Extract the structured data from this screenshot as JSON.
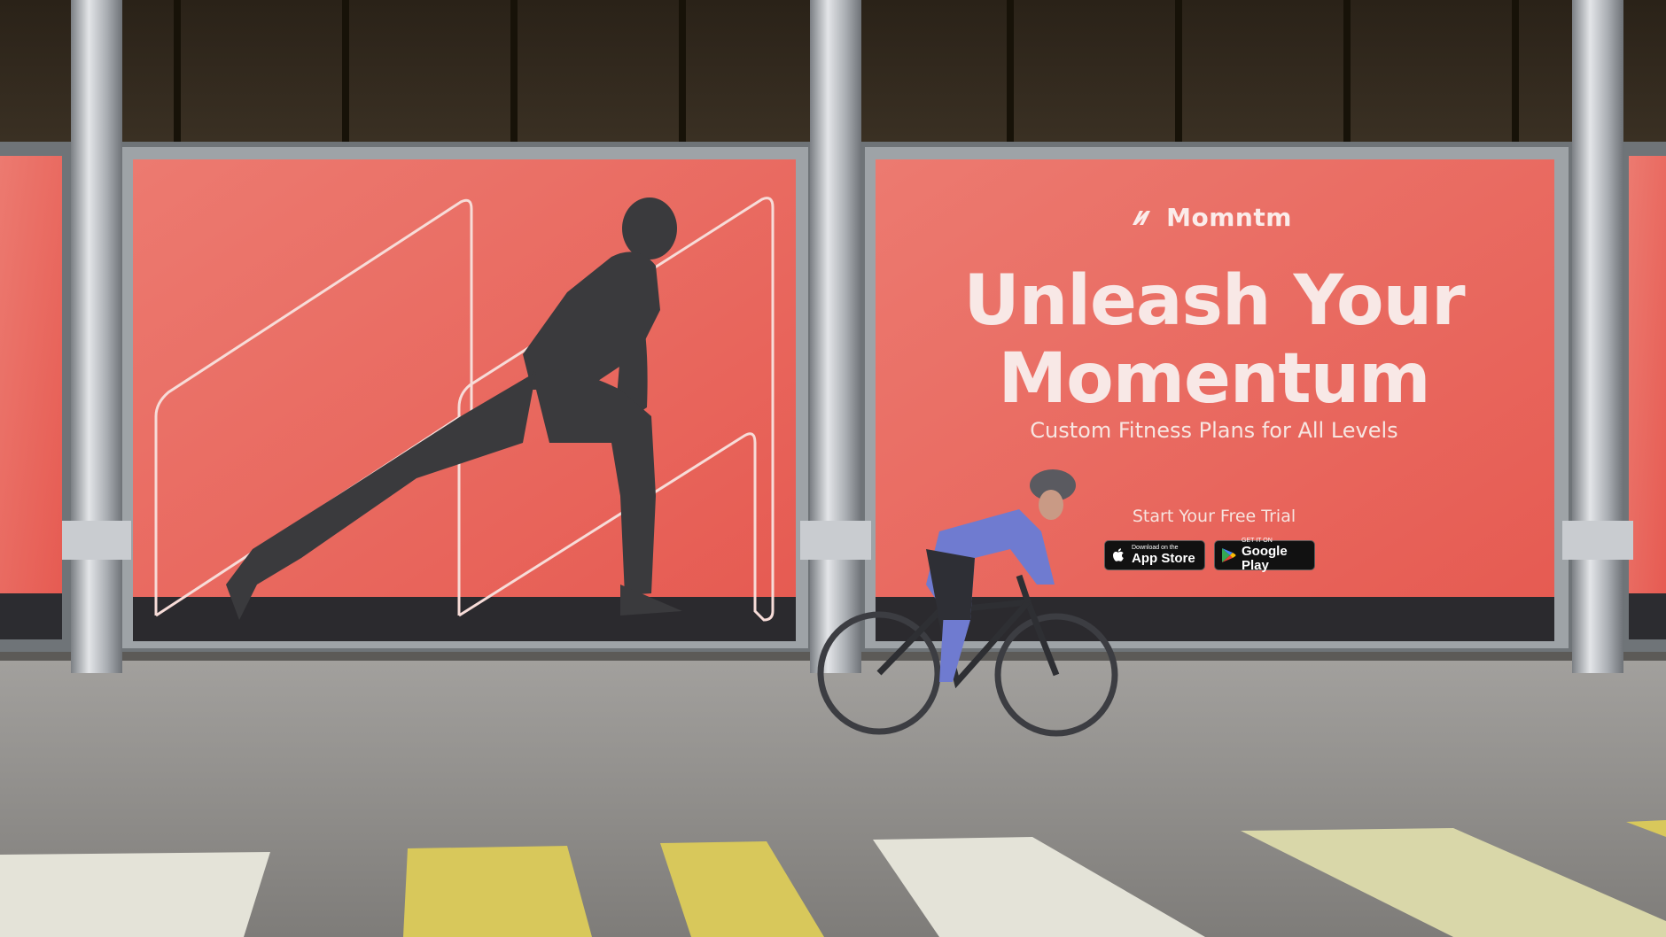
{
  "billboard": {
    "brand": "Momntm",
    "headline_line1": "Unleash Your",
    "headline_line2": "Momentum",
    "subheadline": "Custom Fitness Plans for All Levels",
    "cta": "Start Your Free Trial",
    "app_store": {
      "small": "Download on the",
      "big": "App Store"
    },
    "google_play": {
      "small": "GET IT ON",
      "big": "Google Play"
    }
  },
  "colors": {
    "billboard_red": "#e9665e",
    "pole": "#b9bcc0",
    "pavement": "#8d8b88",
    "crosswalk_yellow": "#d8c85b",
    "crosswalk_white": "#e4e3d8"
  }
}
